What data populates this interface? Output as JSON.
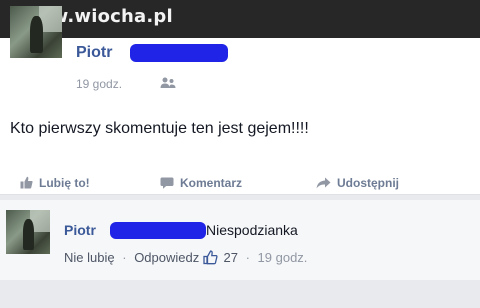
{
  "watermark": {
    "text": "www.wiocha.pl"
  },
  "post": {
    "author": "Piotr",
    "timestamp": "19 godz.",
    "audience_icon": "friends-icon",
    "text": "Kto pierwszy skomentuje ten jest gejem!!!!"
  },
  "actions": {
    "like": "Lubię to!",
    "comment": "Komentarz",
    "share": "Udostępnij"
  },
  "comment": {
    "author": "Piotr",
    "text": "Niespodzianka",
    "unlike": "Nie lubię",
    "reply": "Odpowiedz",
    "separator": "·",
    "like_count": "27",
    "timestamp": "19 godz."
  },
  "colors": {
    "link_blue": "#3b5998",
    "redaction": "#1f24e6",
    "watermark_bar": "#272727"
  }
}
